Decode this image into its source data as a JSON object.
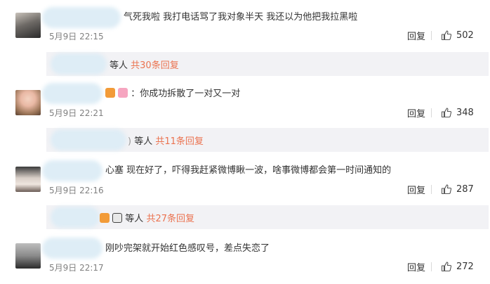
{
  "comments": [
    {
      "text": "气死我啦 我打电话骂了我对象半天 我还以为他把我拉黑啦",
      "time": "5月9日 22:15",
      "reply_label": "回复",
      "likes": "502",
      "sub": {
        "suffix": "等人",
        "link": "共30条回复"
      }
    },
    {
      "text": "：你成功拆散了一对又一对",
      "time": "5月9日 22:21",
      "reply_label": "回复",
      "likes": "348",
      "sub": {
        "partial": ")",
        "suffix": "等人",
        "link": "共11条回复"
      }
    },
    {
      "text": "心塞 现在好了，吓得我赶紧微博瞅一波，啥事微博都会第一时间通知的",
      "time": "5月9日 22:16",
      "reply_label": "回复",
      "likes": "287",
      "sub": {
        "suffix": "等人",
        "link": "共27条回复"
      }
    },
    {
      "text": "刚吵完架就开始红色感叹号，差点失恋了",
      "time": "5月9日 22:17",
      "reply_label": "回复",
      "likes": "272"
    }
  ],
  "colors": {
    "link": "#eb7350",
    "time": "#808080",
    "sub_bg": "#f2f2f5"
  }
}
